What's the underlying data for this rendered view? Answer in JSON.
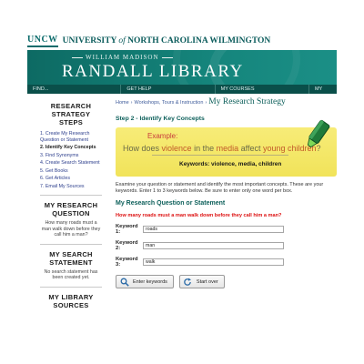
{
  "university": {
    "logo": "UNCW",
    "name_pre": "UNIVERSITY ",
    "name_of": "of",
    "name_post": " NORTH CAROLINA WILMINGTON"
  },
  "library": {
    "subtitle": "WILLIAM MADISON",
    "title": "RANDALL LIBRARY"
  },
  "nav": [
    "FIND...",
    "GET HELP",
    "MY COURSES",
    "MY"
  ],
  "sidebar": {
    "steps_heading": "RESEARCH STRATEGY STEPS",
    "steps": [
      "1. Create My Research Question or Statement",
      "2. Identify Key Concepts",
      "3. Find Synonyms",
      "4. Create Search Statement",
      "5. Get Books",
      "6. Get Articles",
      "7. Email My Sources"
    ],
    "active_step": 1,
    "question_heading": "MY RESEARCH QUESTION",
    "question_text": "How many roads must a man walk down before they call him a man?",
    "search_heading": "MY SEARCH STATEMENT",
    "search_text": "No search statement has been created yet.",
    "sources_heading": "MY LIBRARY SOURCES"
  },
  "breadcrumb": {
    "home": "Home",
    "sep1": "›",
    "workshops": "Workshops, Tours & Instruction",
    "sep2": "›",
    "current": "My Research Strategy"
  },
  "step_title": "Step 2 - Identify Key Concepts",
  "example": {
    "label": "Example:",
    "q1": "How does ",
    "q_hl1": "violence",
    "q2": " in the ",
    "q_hl2": "media",
    "q3": " affect ",
    "q_hl3": "young children",
    "q4": "?",
    "keywords": "Keywords: violence, media, children"
  },
  "instructions": "Examine your question or statement and identify the most important concepts. These are your keywords. Enter 1 to 3 keywords below. Be sure to enter only one word per box.",
  "section_title": "My Research Question or Statement",
  "question": "How many roads must a man walk down before they call him a man?",
  "keywords": [
    {
      "label": "Keyword 1:",
      "value": "roads"
    },
    {
      "label": "Keyword 2:",
      "value": "man"
    },
    {
      "label": "Keyword 3:",
      "value": "walk"
    }
  ],
  "buttons": {
    "enter": "Enter keywords",
    "start_over": "Start over"
  },
  "colors": {
    "teal": "#0c5f5a",
    "banner": "#15857c",
    "nav": "#0a4f4a",
    "example_bg": "#f1e35a",
    "question_red": "#dd1111"
  },
  "icons": {
    "enter": "magnifier-icon",
    "start_over": "refresh-icon",
    "marker": "highlighter-icon"
  }
}
